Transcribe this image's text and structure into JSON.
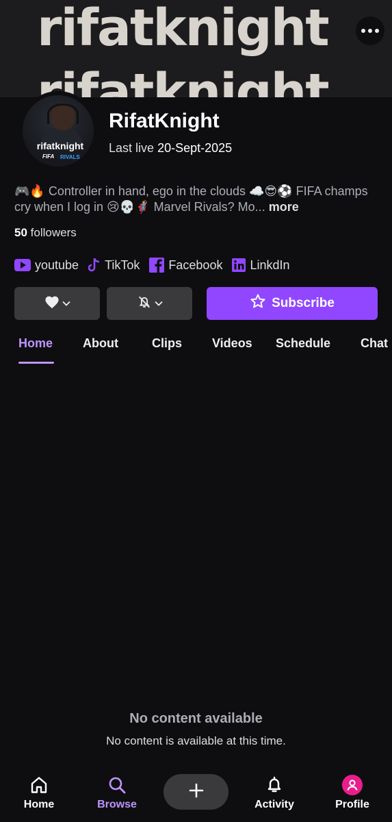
{
  "banner": {
    "text": "rifatknight"
  },
  "channel": {
    "avatar_text": "rifatknight",
    "avatar_logo_left": "FIFA",
    "avatar_logo_right": "RIVALS",
    "name": "RifatKnight",
    "last_live_label": "Last live",
    "last_live_date": "20-Sept-2025",
    "bio": "🎮🔥 Controller in hand, ego in the clouds ☁️😎⚽ FIFA champs cry when I log in 😢💀🦸 Marvel Rivals? Mo...",
    "bio_more": "more",
    "followers_count": "50",
    "followers_label": "followers"
  },
  "socials": [
    {
      "label": "youtube",
      "icon": "youtube-icon"
    },
    {
      "label": "TikTok",
      "icon": "tiktok-icon"
    },
    {
      "label": "Facebook",
      "icon": "facebook-icon"
    },
    {
      "label": "LinkdIn",
      "icon": "linkedin-icon"
    }
  ],
  "actions": {
    "subscribe_label": "Subscribe"
  },
  "tabs": [
    {
      "label": "Home",
      "active": true
    },
    {
      "label": "About"
    },
    {
      "label": "Clips"
    },
    {
      "label": "Videos"
    },
    {
      "label": "Schedule"
    },
    {
      "label": "Chat"
    }
  ],
  "empty": {
    "title": "No content available",
    "subtitle": "No content is available at this time."
  },
  "nav": {
    "home": "Home",
    "browse": "Browse",
    "activity": "Activity",
    "profile": "Profile"
  },
  "colors": {
    "accent": "#9147ff",
    "accent_light": "#bf94ff",
    "background": "#0e0e10",
    "profile_avatar": "#e91e8c"
  }
}
